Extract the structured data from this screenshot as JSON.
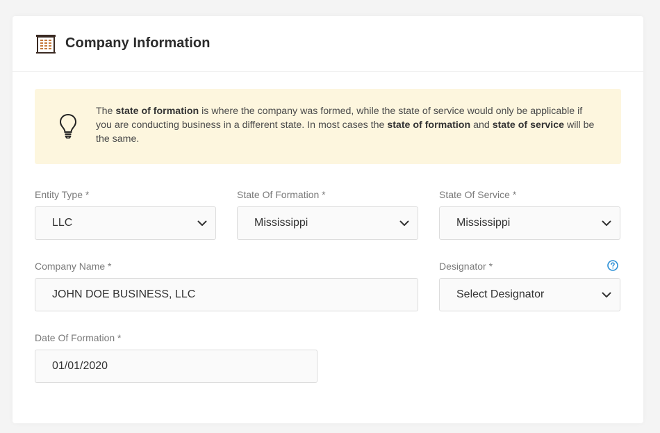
{
  "header": {
    "title": "Company Information",
    "icon": "building-icon"
  },
  "info": {
    "icon": "lightbulb-icon",
    "t1": "The ",
    "b1": "state of formation",
    "t2": " is where the company was formed, while the state of service would only be applicable if you are conducting business in a different state. In most cases the ",
    "b2": "state of formation",
    "t3": " and ",
    "b3": "state of service",
    "t4": " will be the same.",
    "bg_color": "#fdf6de"
  },
  "form": {
    "entity_type": {
      "label": "Entity Type *",
      "value": "LLC"
    },
    "state_of_formation": {
      "label": "State Of Formation *",
      "value": "Mississippi"
    },
    "state_of_service": {
      "label": "State Of Service *",
      "value": "Mississippi"
    },
    "company_name": {
      "label": "Company Name *",
      "value": "JOHN DOE BUSINESS, LLC"
    },
    "designator": {
      "label": "Designator *",
      "value": "Select Designator",
      "help_icon": "help-circle-icon"
    },
    "date_of_formation": {
      "label": "Date Of Formation *",
      "value": "01/01/2020"
    }
  },
  "colors": {
    "accent": "#2a8fd6",
    "label": "#7a7a7a",
    "text": "#333333"
  }
}
